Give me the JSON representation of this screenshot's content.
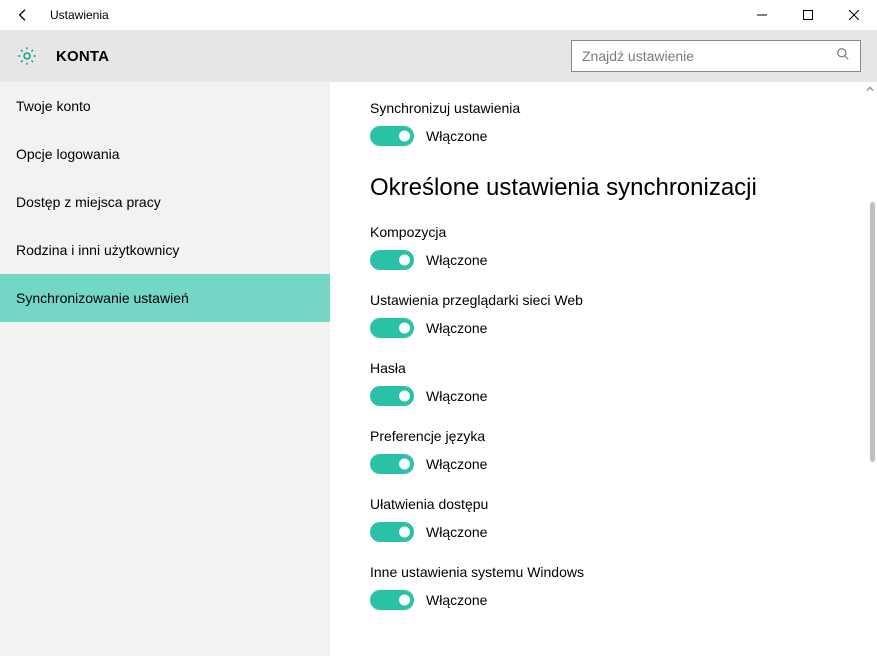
{
  "titlebar": {
    "title": "Ustawienia"
  },
  "header": {
    "section": "KONTA",
    "search_placeholder": "Znajdź ustawienie"
  },
  "sidebar": {
    "items": [
      {
        "label": "Twoje konto",
        "selected": false
      },
      {
        "label": "Opcje logowania",
        "selected": false
      },
      {
        "label": "Dostęp z miejsca pracy",
        "selected": false
      },
      {
        "label": "Rodzina i inni użytkownicy",
        "selected": false
      },
      {
        "label": "Synchronizowanie ustawień",
        "selected": true
      }
    ]
  },
  "content": {
    "top_setting": {
      "label": "Synchronizuj ustawienia",
      "state": "Włączone",
      "on": true
    },
    "group_heading": "Określone ustawienia synchronizacji",
    "settings": [
      {
        "label": "Kompozycja",
        "state": "Włączone",
        "on": true
      },
      {
        "label": "Ustawienia przeglądarki sieci Web",
        "state": "Włączone",
        "on": true
      },
      {
        "label": "Hasła",
        "state": "Włączone",
        "on": true
      },
      {
        "label": "Preferencje języka",
        "state": "Włączone",
        "on": true
      },
      {
        "label": "Ułatwienia dostępu",
        "state": "Włączone",
        "on": true
      },
      {
        "label": "Inne ustawienia systemu Windows",
        "state": "Włączone",
        "on": true
      }
    ]
  }
}
